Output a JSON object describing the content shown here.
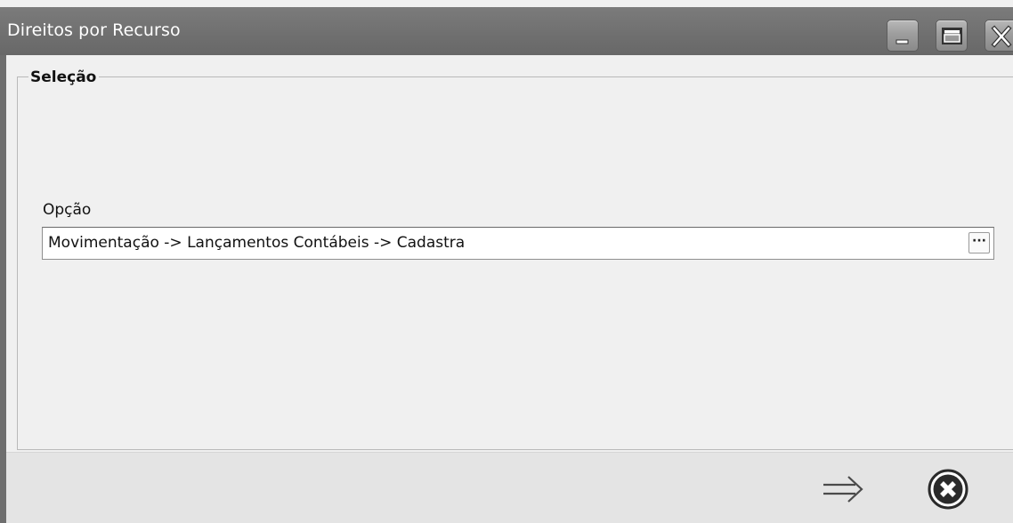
{
  "window": {
    "title": "Direitos por Recurso",
    "controls": {
      "minimize_icon": "minimize-icon",
      "maximize_icon": "maximize-icon",
      "close_icon": "close-icon"
    }
  },
  "selection_group": {
    "legend": "Seleção",
    "option_field": {
      "label": "Opção",
      "value": "Movimentação -> Lançamentos Contábeis -> Cadastra",
      "lookup_button_label": "···"
    }
  },
  "footer": {
    "confirm_icon": "arrow-right-icon",
    "cancel_icon": "circle-x-icon"
  },
  "colors": {
    "titlebar": "#707070",
    "background": "#f0f0f0",
    "footer": "#e4e4e4"
  }
}
